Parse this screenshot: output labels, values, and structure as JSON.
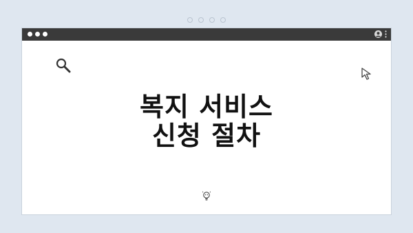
{
  "headline": {
    "line1": "복지 서비스",
    "line2": "신청 절차"
  },
  "icons": {
    "search": "search-icon",
    "cursor": "cursor-icon",
    "bulb": "lightbulb-icon",
    "avatar": "avatar-icon",
    "menu": "kebab-menu-icon"
  },
  "colors": {
    "background": "#dfe7f0",
    "titlebar": "#3a3a3a",
    "window": "#ffffff",
    "text": "#111111"
  }
}
